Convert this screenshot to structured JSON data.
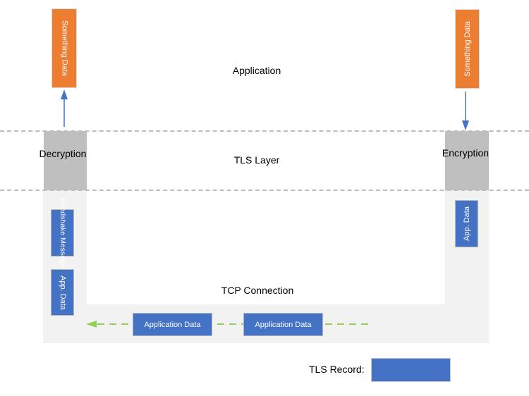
{
  "layers": {
    "application": "Application",
    "tls": "TLS Layer",
    "tcp": "TCP Connection"
  },
  "receiver": {
    "app_box": "Something Data",
    "operation": "Decryption",
    "records": [
      "Handshake Message",
      "App. Data"
    ]
  },
  "sender": {
    "app_box": "Something Data",
    "operation": "Encryption",
    "records": [
      "App. Data"
    ]
  },
  "tcp_stream": {
    "records": [
      "Application Data",
      "Application Data"
    ],
    "direction": "right-to-left"
  },
  "legend": {
    "label": "TLS Record:",
    "swatch_color": "#4472c4"
  },
  "colors": {
    "app_data": "#ed7d31",
    "tls_record": "#4472c4",
    "crypto_block": "#bfbfbf",
    "tcp_region": "#f2f2f2",
    "data_flow_arrow": "#4472c4",
    "tcp_flow_arrow": "#92d050"
  }
}
